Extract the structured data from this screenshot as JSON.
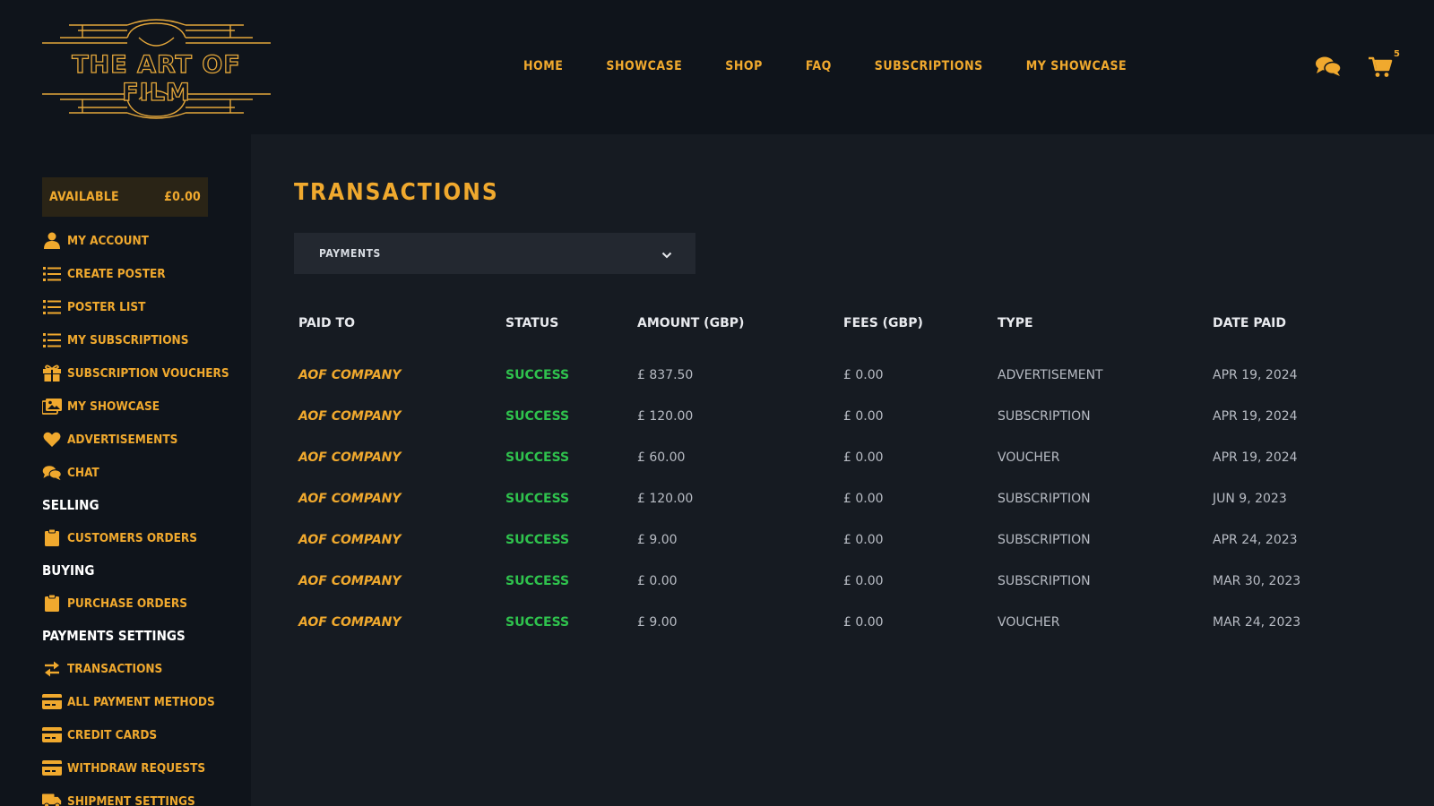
{
  "brand": {
    "name": "THE ART OF FILM",
    "accent_color": "#f0a92e",
    "success_color": "#2fc24d",
    "background_color": "#0f141b",
    "content_background_color": "#161b22"
  },
  "nav": {
    "items": [
      "HOME",
      "SHOWCASE",
      "SHOP",
      "FAQ",
      "SUBSCRIPTIONS",
      "MY SHOWCASE"
    ]
  },
  "top_icons": {
    "chat_icon": "chat-bubbles-icon",
    "cart_icon": "shopping-cart-icon",
    "cart_count": "5"
  },
  "sidebar": {
    "balance_label": "AVAILABLE",
    "balance_value": "£0.00",
    "items": [
      {
        "label": "MY ACCOUNT",
        "icon": "user-icon"
      },
      {
        "label": "CREATE POSTER",
        "icon": "list-icon"
      },
      {
        "label": "POSTER LIST",
        "icon": "list-icon"
      },
      {
        "label": "MY SUBSCRIPTIONS",
        "icon": "list-icon"
      },
      {
        "label": "SUBSCRIPTION VOUCHERS",
        "icon": "gift-icon"
      },
      {
        "label": "MY SHOWCASE",
        "icon": "images-icon"
      },
      {
        "label": "ADVERTISEMENTS",
        "icon": "heart-icon"
      },
      {
        "label": "CHAT",
        "icon": "chat-bubbles-icon"
      }
    ],
    "selling_heading": "SELLING",
    "selling_items": [
      {
        "label": "CUSTOMERS ORDERS",
        "icon": "clipboard-icon"
      }
    ],
    "buying_heading": "BUYING",
    "buying_items": [
      {
        "label": "PURCHASE ORDERS",
        "icon": "clipboard-icon"
      }
    ],
    "payments_heading": "PAYMENTS SETTINGS",
    "payments_items": [
      {
        "label": "TRANSACTIONS",
        "icon": "exchange-icon"
      },
      {
        "label": "ALL PAYMENT METHODS",
        "icon": "credit-card-icon"
      },
      {
        "label": "CREDIT CARDS",
        "icon": "credit-card-icon"
      },
      {
        "label": "WITHDRAW REQUESTS",
        "icon": "credit-card-icon"
      },
      {
        "label": "SHIPMENT SETTINGS",
        "icon": "truck-icon"
      }
    ]
  },
  "main": {
    "title": "TRANSACTIONS",
    "filter": {
      "selected": "PAYMENTS",
      "icon": "chevron-down-icon"
    },
    "table": {
      "columns": [
        "PAID TO",
        "STATUS",
        "AMOUNT (GBP)",
        "FEES (GBP)",
        "TYPE",
        "DATE PAID"
      ],
      "rows": [
        [
          "AOF COMPANY",
          "SUCCESS",
          "£ 837.50",
          "£ 0.00",
          "ADVERTISEMENT",
          "APR 19, 2024"
        ],
        [
          "AOF COMPANY",
          "SUCCESS",
          "£ 120.00",
          "£ 0.00",
          "SUBSCRIPTION",
          "APR 19, 2024"
        ],
        [
          "AOF COMPANY",
          "SUCCESS",
          "£ 60.00",
          "£ 0.00",
          "VOUCHER",
          "APR 19, 2024"
        ],
        [
          "AOF COMPANY",
          "SUCCESS",
          "£ 120.00",
          "£ 0.00",
          "SUBSCRIPTION",
          "JUN 9, 2023"
        ],
        [
          "AOF COMPANY",
          "SUCCESS",
          "£ 9.00",
          "£ 0.00",
          "SUBSCRIPTION",
          "APR 24, 2023"
        ],
        [
          "AOF COMPANY",
          "SUCCESS",
          "£ 0.00",
          "£ 0.00",
          "SUBSCRIPTION",
          "MAR 30, 2023"
        ],
        [
          "AOF COMPANY",
          "SUCCESS",
          "£ 9.00",
          "£ 0.00",
          "VOUCHER",
          "MAR 24, 2023"
        ]
      ]
    }
  }
}
